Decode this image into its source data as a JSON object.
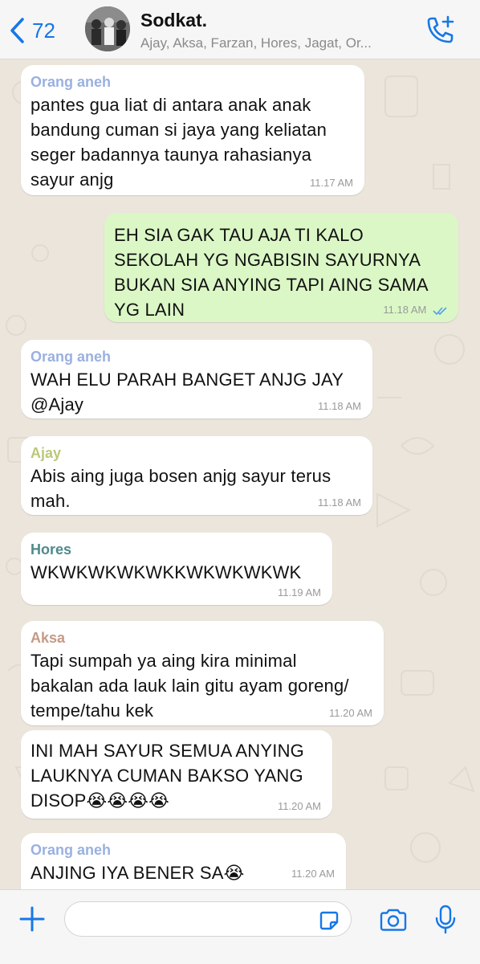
{
  "header": {
    "back_count": "72",
    "title": "Sodkat.",
    "subtitle": "Ajay, Aksa, Farzan, Hores, Jagat, Or..."
  },
  "colors": {
    "accent": "#1677e8",
    "incoming_bubble": "#ffffff",
    "outgoing_bubble": "#dbf7c6",
    "chat_bg": "#ece5dc",
    "sender_orang_aneh": "#9ab0e0",
    "sender_ajay": "#b8c97a",
    "sender_hores": "#4f8a8b",
    "sender_aksa": "#c49a86"
  },
  "messages": [
    {
      "direction": "in",
      "sender": "Orang aneh",
      "lines": [
        "pantes gua liat di antara anak anak",
        "bandung cuman si jaya yang keliatan",
        "seger badannya taunya rahasianya",
        "sayur anjg"
      ],
      "time": "11.17 AM"
    },
    {
      "direction": "out",
      "sender": "",
      "lines": [
        "EH SIA GAK TAU AJA TI KALO",
        "SEKOLAH YG NGABISIN SAYURNYA",
        "BUKAN SIA ANYING TAPI AING SAMA",
        "YG LAIN"
      ],
      "time": "11.18 AM",
      "status": "read"
    },
    {
      "direction": "in",
      "sender": "Orang aneh",
      "lines": [
        "WAH ELU PARAH BANGET ANJG JAY",
        "@Ajay"
      ],
      "time": "11.18 AM"
    },
    {
      "direction": "in",
      "sender": "Ajay",
      "lines": [
        "Abis aing juga bosen anjg sayur terus",
        "mah."
      ],
      "time": "11.18 AM"
    },
    {
      "direction": "in",
      "sender": "Hores",
      "lines": [
        "WKWKWKWKWKKWKWKWKWK"
      ],
      "time": "11.19 AM"
    },
    {
      "direction": "in",
      "sender": "Aksa",
      "lines": [
        "Tapi sumpah ya aing kira minimal",
        "bakalan ada lauk lain gitu ayam goreng/",
        "tempe/tahu kek"
      ],
      "time": "11.20 AM"
    },
    {
      "direction": "in",
      "sender": "",
      "lines": [
        "INI MAH SAYUR SEMUA ANYING",
        "LAUKNYA CUMAN BAKSO YANG",
        "DISOP😭😭😭😭"
      ],
      "time": "11.20 AM"
    },
    {
      "direction": "in",
      "sender": "Orang aneh",
      "lines": [
        "ANJING IYA BENER SA😭"
      ],
      "time": "11.20 AM"
    }
  ],
  "composer": {
    "value": "",
    "placeholder": ""
  },
  "icons": {
    "back": "chevron-left-icon",
    "call": "add-call-icon",
    "plus": "plus-icon",
    "sticker": "sticker-icon",
    "camera": "camera-icon",
    "mic": "microphone-icon"
  }
}
